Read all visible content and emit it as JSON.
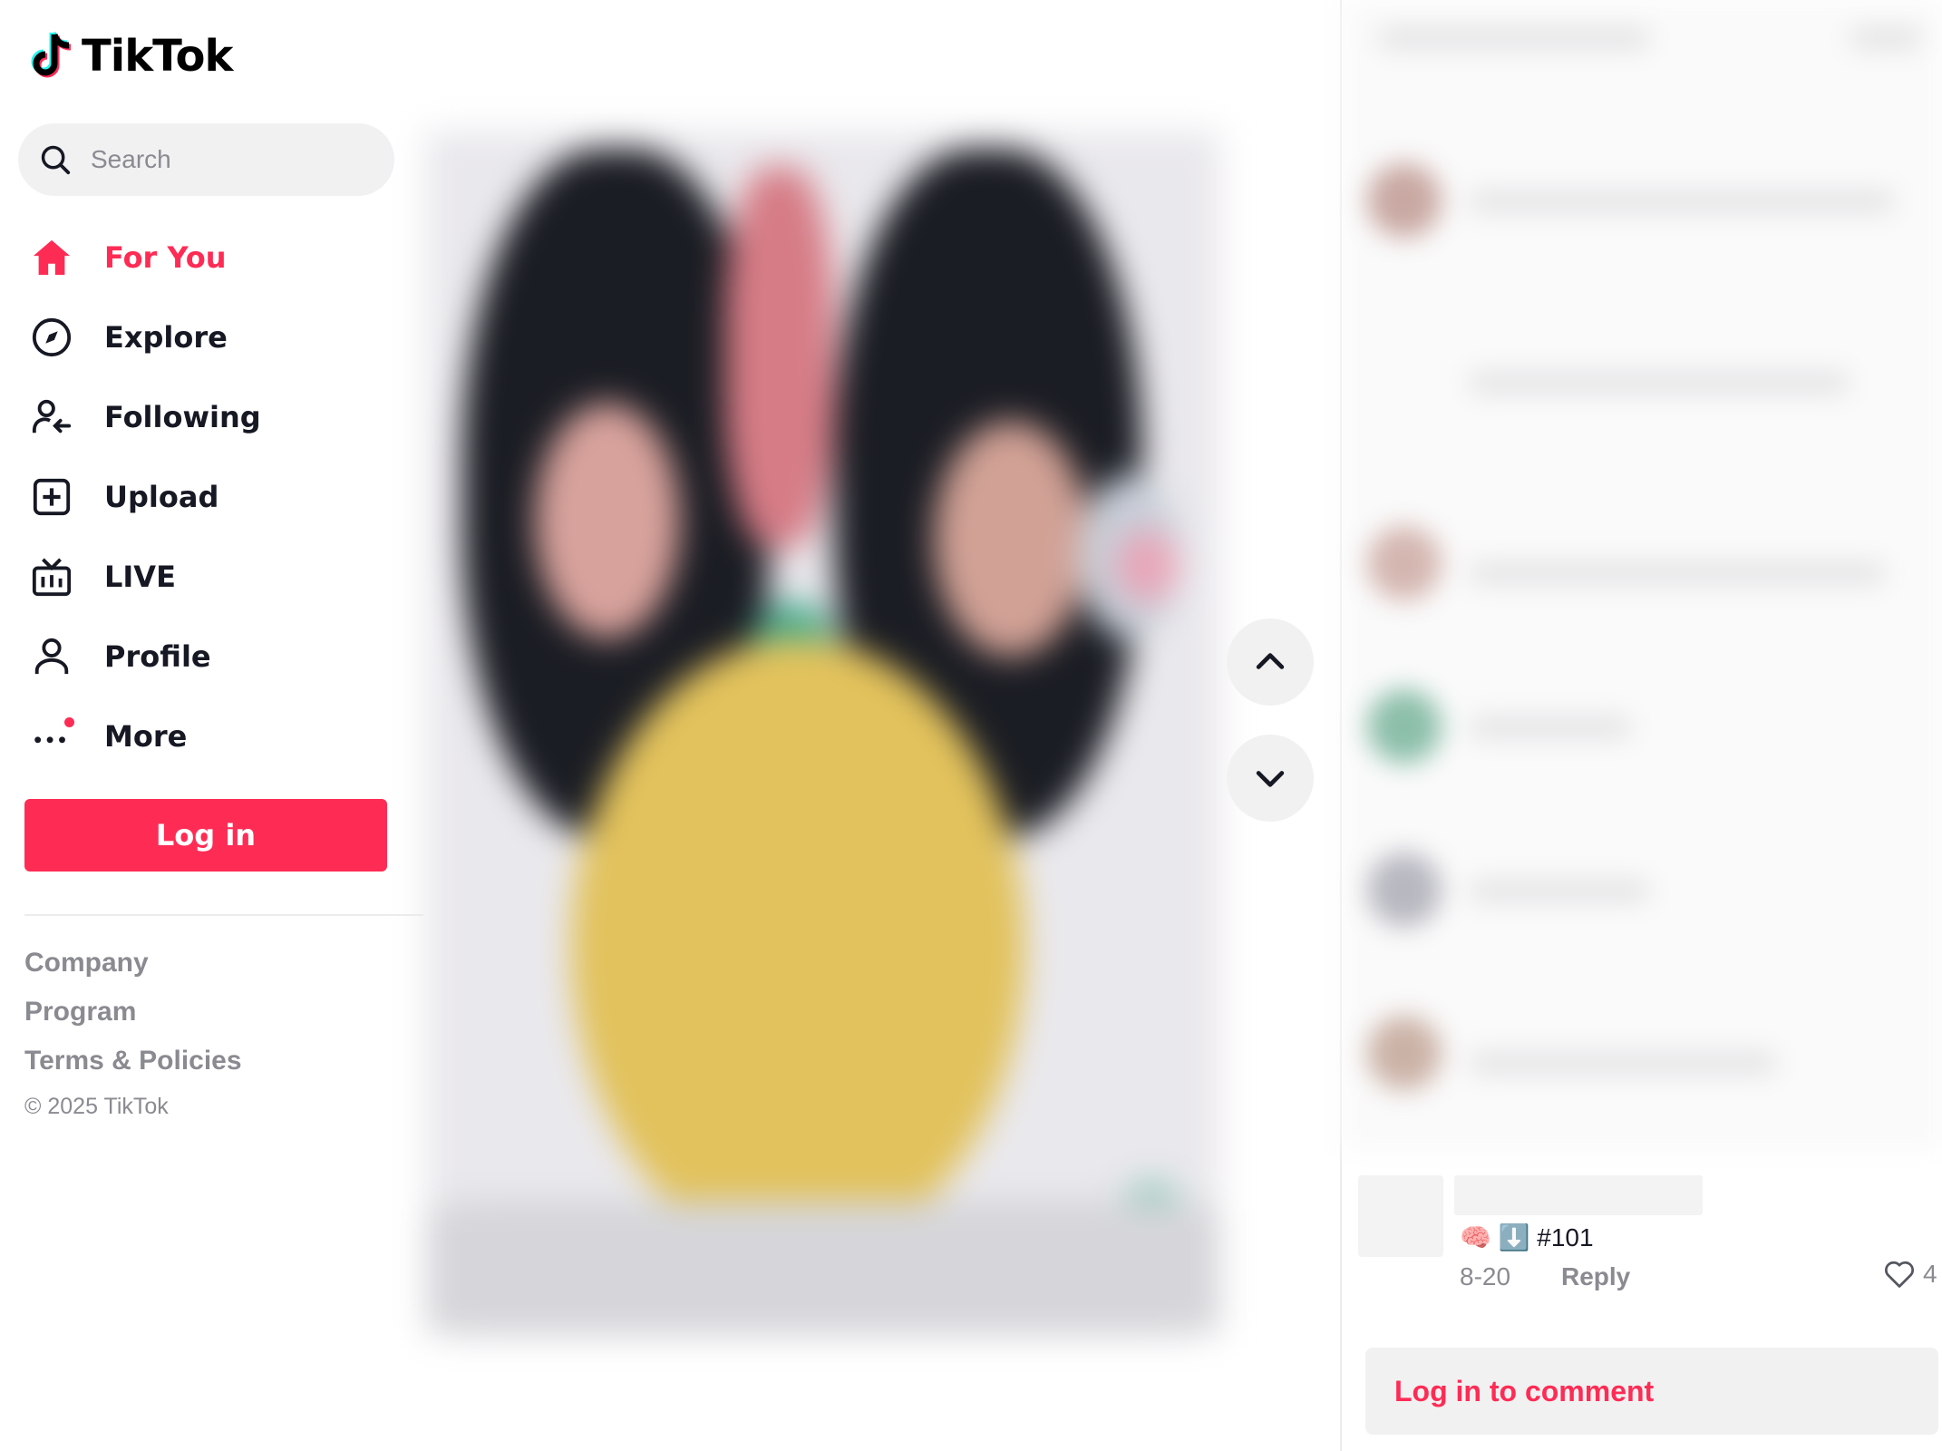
{
  "app": {
    "name": "TikTok"
  },
  "search": {
    "placeholder": "Search"
  },
  "nav": {
    "items": [
      {
        "label": "For You",
        "icon": "home-icon",
        "active": true
      },
      {
        "label": "Explore",
        "icon": "compass-icon"
      },
      {
        "label": "Following",
        "icon": "following-icon"
      },
      {
        "label": "Upload",
        "icon": "upload-icon"
      },
      {
        "label": "LIVE",
        "icon": "live-tv-icon"
      },
      {
        "label": "Profile",
        "icon": "profile-icon"
      },
      {
        "label": "More",
        "icon": "more-icon",
        "has_notification_dot": true
      }
    ]
  },
  "sidebar": {
    "login_label": "Log in"
  },
  "footer": {
    "links": [
      "Company",
      "Program",
      "Terms & Policies"
    ],
    "copyright": "© 2025 TikTok"
  },
  "comment": {
    "text": "🧠 ⬇️ #101",
    "date": "8-20",
    "reply_label": "Reply",
    "likes": "4"
  },
  "comments_panel": {
    "login_to_comment": "Log in to comment"
  },
  "colors": {
    "accent": "#fe2c55",
    "muted_text": "#8a8b91",
    "pill_bg": "#f1f1f2"
  }
}
